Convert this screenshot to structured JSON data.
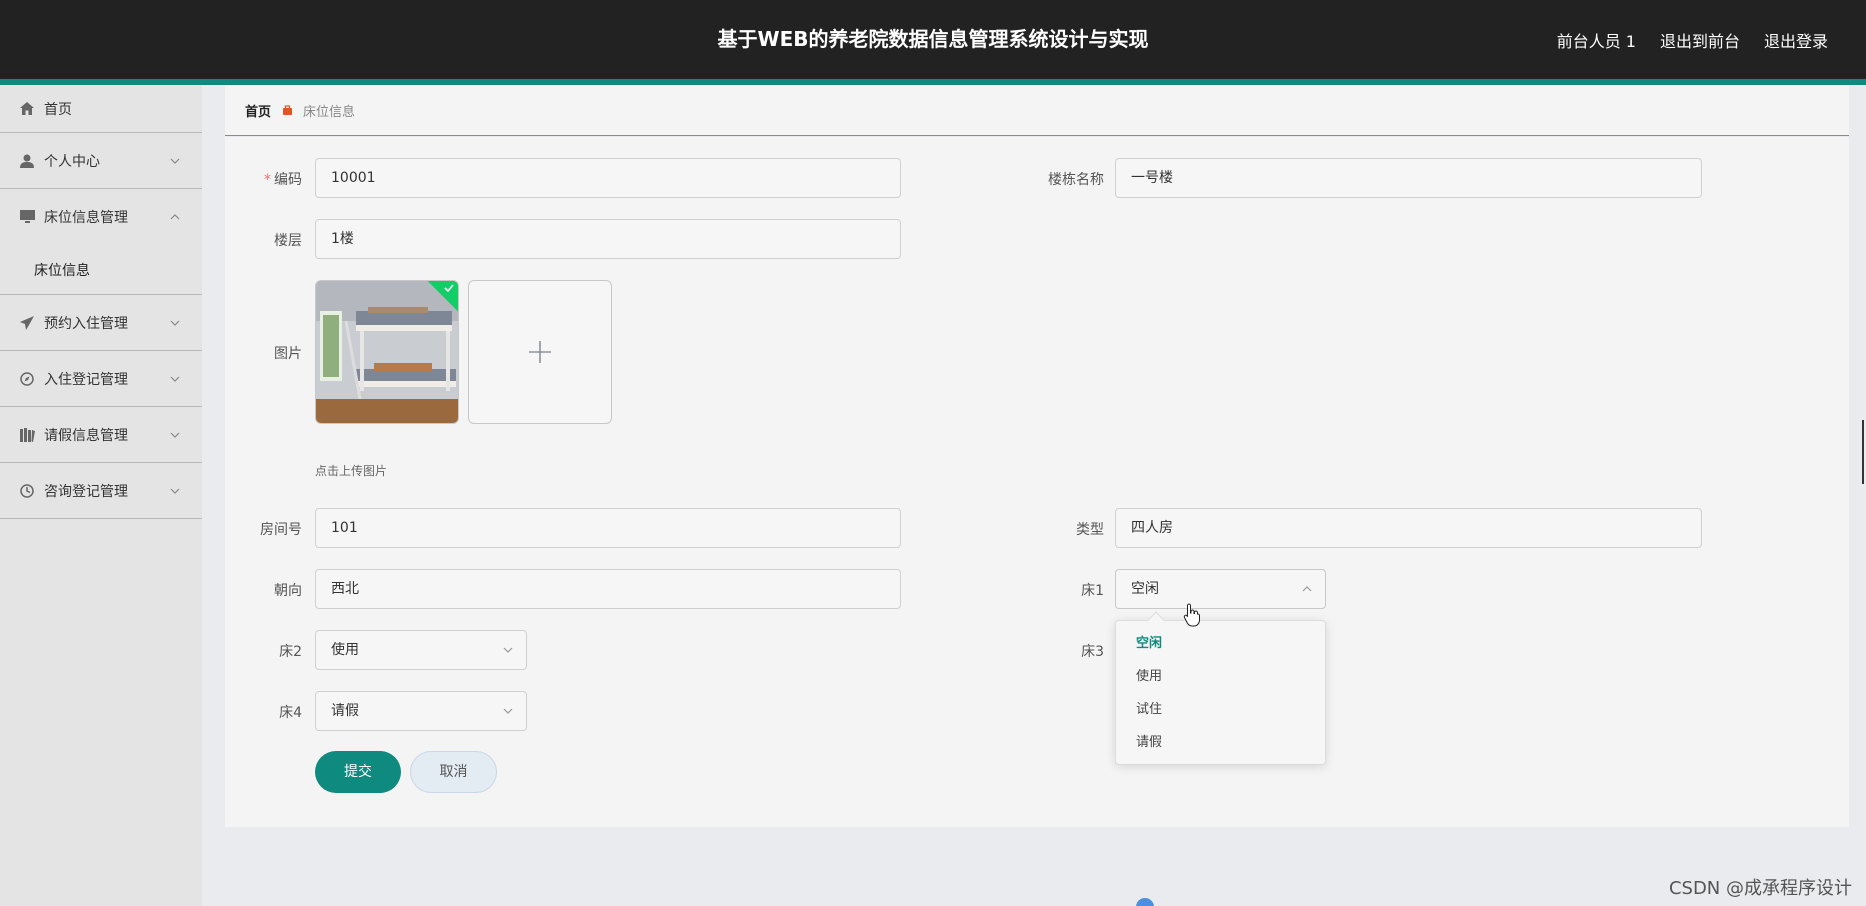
{
  "header": {
    "title": "基于WEB的养老院数据信息管理系统设计与实现",
    "links": [
      "前台人员 1",
      "退出到前台",
      "退出登录"
    ]
  },
  "sidebar": {
    "items": [
      {
        "label": "首页",
        "icon": "home-icon"
      },
      {
        "label": "个人中心",
        "icon": "user-icon"
      },
      {
        "label": "床位信息管理",
        "icon": "monitor-icon"
      },
      {
        "label": "预约入住管理",
        "icon": "send-icon"
      },
      {
        "label": "入住登记管理",
        "icon": "compass-icon"
      },
      {
        "label": "请假信息管理",
        "icon": "books-icon"
      },
      {
        "label": "咨询登记管理",
        "icon": "clock-icon"
      }
    ],
    "submenu": [
      "床位信息"
    ]
  },
  "breadcrumb": {
    "home": "首页",
    "current": "床位信息"
  },
  "form": {
    "code": {
      "label": "编码",
      "value": "10001"
    },
    "building": {
      "label": "楼栋名称",
      "value": "一号楼"
    },
    "floor": {
      "label": "楼层",
      "value": "1楼"
    },
    "image": {
      "label": "图片",
      "tip": "点击上传图片"
    },
    "room": {
      "label": "房间号",
      "value": "101"
    },
    "type": {
      "label": "类型",
      "value": "四人房"
    },
    "orientation": {
      "label": "朝向",
      "value": "西北"
    },
    "bed1": {
      "label": "床1",
      "value": "空闲"
    },
    "bed2": {
      "label": "床2",
      "value": "使用"
    },
    "bed3": {
      "label": "床3"
    },
    "bed4": {
      "label": "床4",
      "value": "请假"
    },
    "submit": "提交",
    "cancel": "取消"
  },
  "dropdown": {
    "options": [
      "空闲",
      "使用",
      "试住",
      "请假"
    ],
    "selected": "空闲"
  },
  "watermark": "CSDN @成承程序设计",
  "colors": {
    "topbar": "#222222",
    "accent": "#0f8a7e",
    "sidebar": "#e4e4e4",
    "panel": "#f4f4f4",
    "breadcrumb_icon": "#e6541e"
  }
}
